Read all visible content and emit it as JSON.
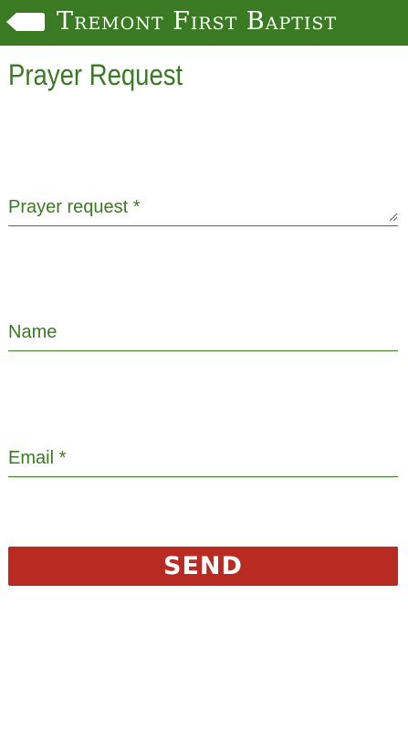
{
  "header": {
    "title": "Tremont First Baptist",
    "back_icon": "back-arrow-icon"
  },
  "page": {
    "title": "Prayer Request"
  },
  "form": {
    "prayer_request_label": "Prayer request *",
    "name_label": "Name",
    "email_label": "Email *",
    "send_label": "SEND"
  },
  "colors": {
    "brand_green": "#3a7a23",
    "send_red": "#b82a22",
    "background": "#ffffff"
  }
}
